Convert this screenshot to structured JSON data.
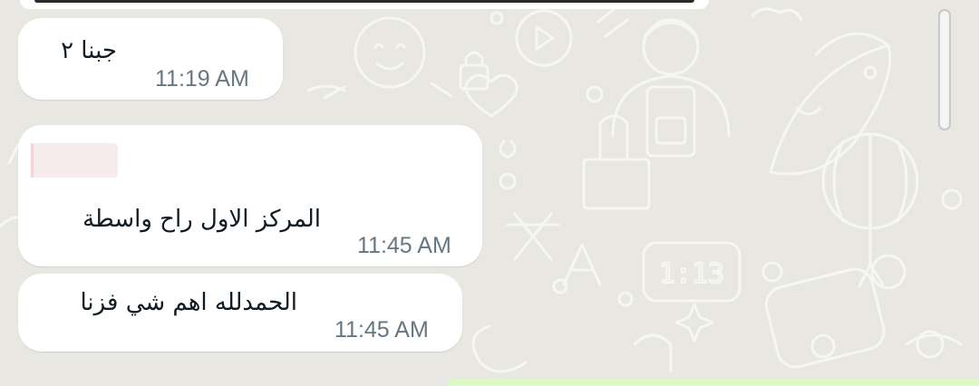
{
  "colors": {
    "wallpaper": "#e8e7e2",
    "incoming_bubble": "#ffffff",
    "outgoing_bubble": "#dcf8c6",
    "message_text": "#111b21",
    "timestamp_text": "#667781",
    "quoted_preview": "#f6ecec"
  },
  "messages": [
    {
      "direction": "incoming",
      "text": "جبنا ٢",
      "time": "11:19 AM"
    },
    {
      "direction": "incoming",
      "text": "المركز الاول راح واسطة",
      "time": "11:45 AM",
      "has_quoted_preview": true
    },
    {
      "direction": "incoming",
      "text": "الحمدلله اهم شي فزنا",
      "time": "11:45 AM"
    }
  ],
  "wallpaper_icons": [
    "sun-icon",
    "play-icon",
    "person-icon",
    "fish-icon",
    "lantern-icon",
    "cactus-icon",
    "clock-icon",
    "translate-icon",
    "sparkle-icon",
    "heart-icon"
  ],
  "clock_icon_text": "1:13"
}
